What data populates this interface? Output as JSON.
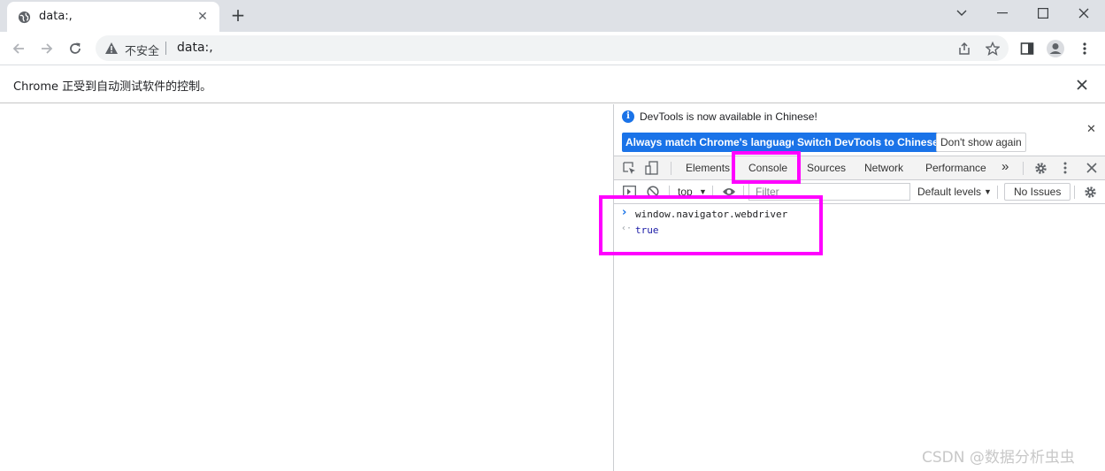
{
  "window": {
    "tab_title": "data:,",
    "tab_close_glyph": "✕",
    "new_tab_glyph": "+"
  },
  "toolbar": {
    "security_label": "不安全",
    "url": "data:,"
  },
  "infobar": {
    "message": "Chrome 正受到自动测试软件的控制。"
  },
  "devtools": {
    "info_message": "DevTools is now available in Chinese!",
    "info_icon_glyph": "i",
    "info_close_glyph": "✕",
    "buttons": {
      "match_language": "Always match Chrome's language",
      "switch_chinese": "Switch DevTools to Chinese",
      "dont_show": "Don't show again"
    },
    "tabs": [
      "Elements",
      "Console",
      "Sources",
      "Network",
      "Performance"
    ],
    "more_tabs_glyph": "»",
    "active_tab": "Console",
    "console_bar": {
      "context": "top",
      "filter_placeholder": "Filter",
      "levels": "Default levels",
      "issues": "No Issues"
    },
    "console": {
      "input": "window.navigator.webdriver",
      "result": "true",
      "input_prompt_glyph": "›",
      "result_prompt_glyph": "‹·"
    }
  },
  "watermark": "CSDN @数据分析虫虫",
  "colors": {
    "highlight": "#ff00ff",
    "primary_button": "#1a73e8",
    "tabstrip": "#dee1e6",
    "result_text": "#1a1aa6"
  }
}
